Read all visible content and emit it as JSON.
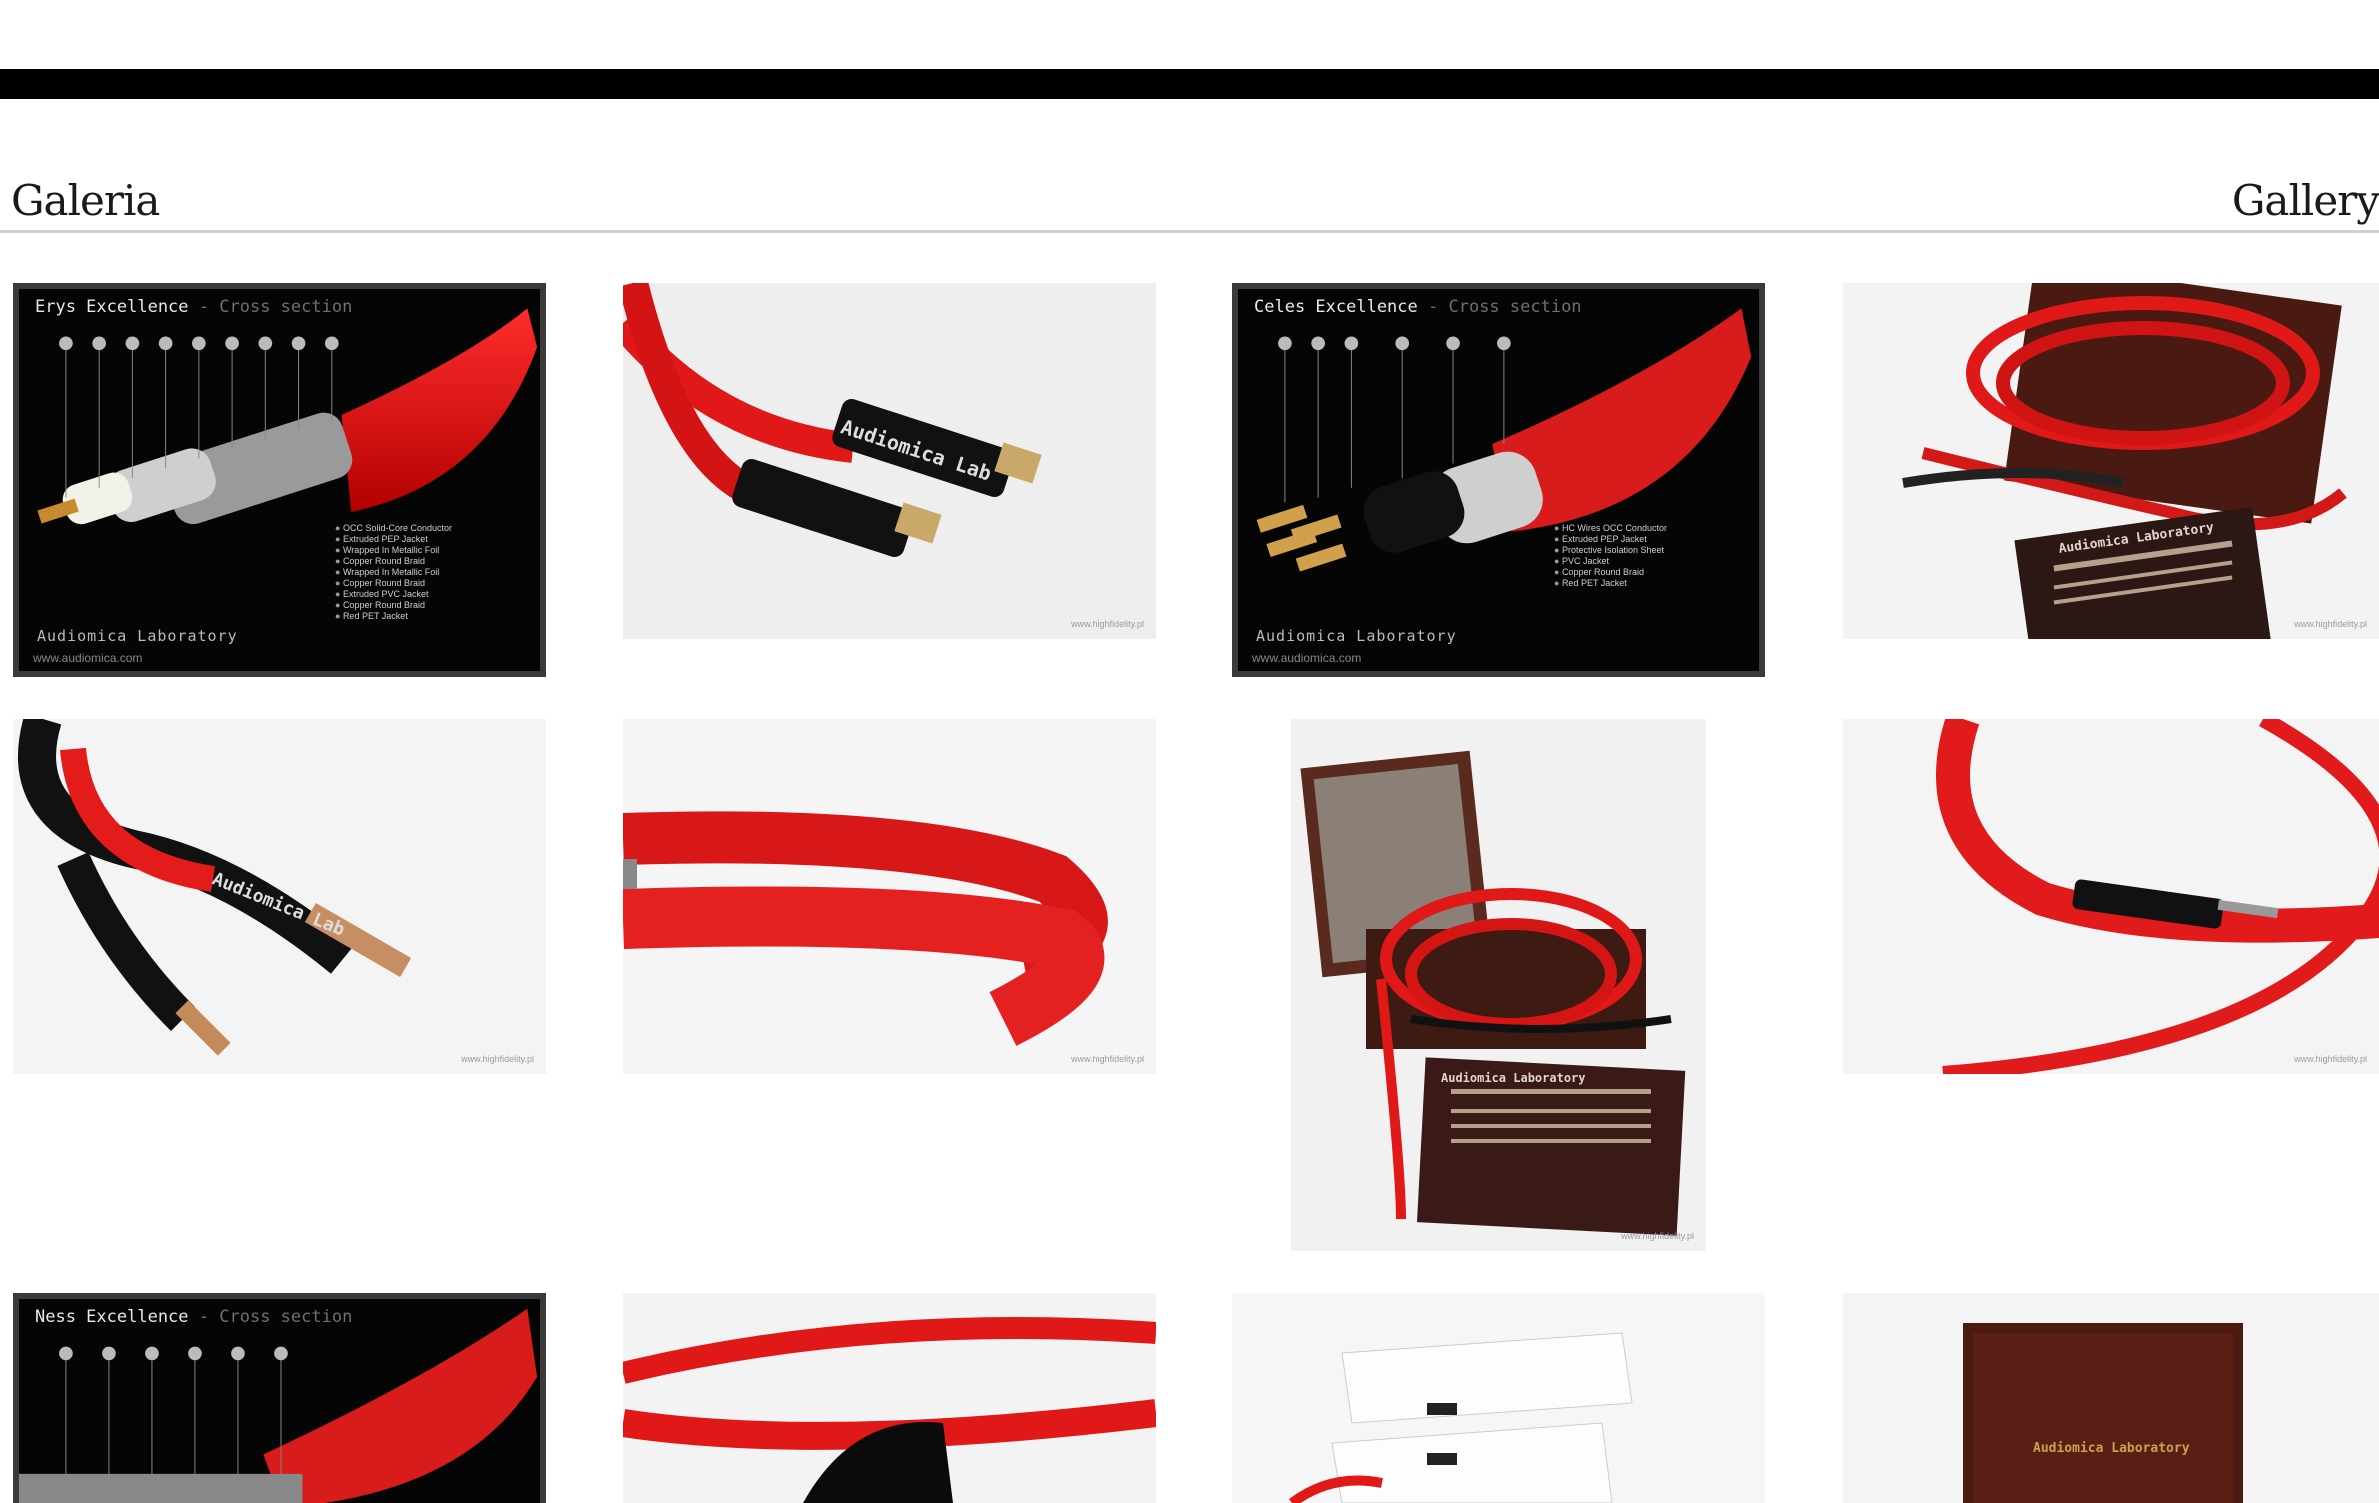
{
  "header": {
    "title_left": "Galeria",
    "title_right": "Gallery"
  },
  "gallery": {
    "items": [
      {
        "kind": "cross-section",
        "title": "Erys Excellence",
        "subtitle": "- Cross section",
        "brand": "Audiomica Laboratory",
        "url": "www.audiomica.com",
        "legend": [
          "OCC Solid-Core Conductor",
          "Extruded PEP Jacket",
          "Wrapped In Metallic Foil",
          "Copper Round Braid",
          "Wrapped In Metallic Foil",
          "Copper Round Braid",
          "Extruded PVC Jacket",
          "Copper Round Braid",
          "Red PET Jacket"
        ]
      },
      {
        "kind": "photo",
        "label": "Audiomica Lab",
        "watermark": "www.highfidelity.pl"
      },
      {
        "kind": "cross-section",
        "title": "Celes Excellence",
        "subtitle": "- Cross section",
        "brand": "Audiomica Laboratory",
        "url": "www.audiomica.com",
        "legend": [
          "HC Wires OCC Conductor",
          "Extruded PEP Jacket",
          "Protective Isolation Sheet",
          "PVC Jacket",
          "Copper Round Braid",
          "Red PET Jacket"
        ]
      },
      {
        "kind": "photo",
        "label": "Audiomica Laboratory",
        "watermark": "www.highfidelity.pl"
      },
      {
        "kind": "photo",
        "label": "Audiomica Lab",
        "watermark": "www.highfidelity.pl"
      },
      {
        "kind": "photo",
        "label": "",
        "watermark": "www.highfidelity.pl"
      },
      {
        "kind": "photo",
        "label": "Audiomica Laboratory",
        "watermark": "www.highfidelity.pl"
      },
      {
        "kind": "photo",
        "label": "",
        "watermark": "www.highfidelity.pl"
      },
      {
        "kind": "cross-section",
        "title": "Ness Excellence",
        "subtitle": "- Cross section",
        "brand": "",
        "url": "",
        "legend": []
      },
      {
        "kind": "photo",
        "label": "",
        "watermark": ""
      },
      {
        "kind": "photo",
        "label": "",
        "watermark": ""
      },
      {
        "kind": "photo",
        "label": "Audiomica Laboratory",
        "watermark": ""
      }
    ]
  }
}
